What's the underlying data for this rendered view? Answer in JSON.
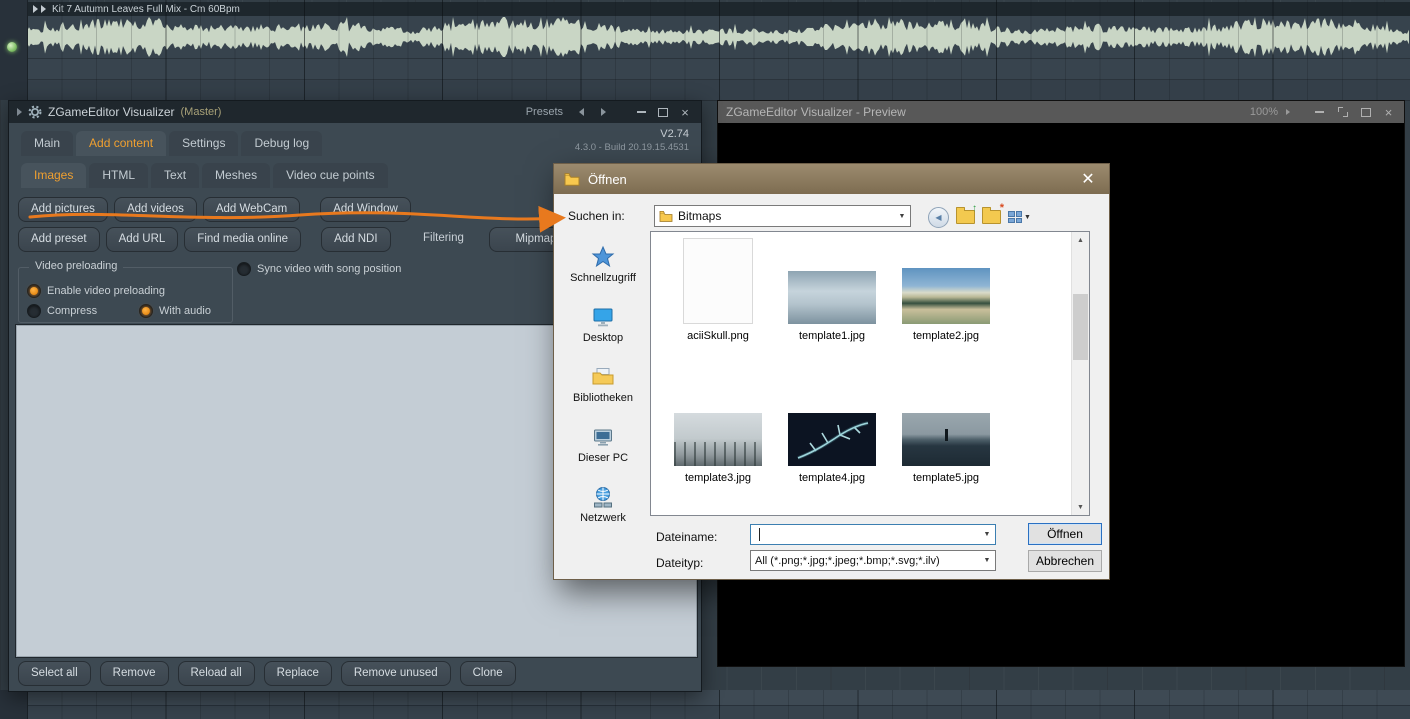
{
  "colors": {
    "accent_orange": "#f08a1d",
    "arrow_orange": "#e8791e",
    "dialog_titlebar": "#8a795f",
    "focus_blue": "#2a70c2"
  },
  "playlist": {
    "track_title": "Kit 7 Autumn Leaves Full Mix - Cm 60Bpm"
  },
  "plugin": {
    "title": "ZGameEditor Visualizer",
    "master": "(Master)",
    "presets_label": "Presets",
    "version": "V2.74",
    "build": "4.3.0 - Build 20.19.15.4531",
    "tabs": [
      {
        "label": "Main"
      },
      {
        "label": "Add content"
      },
      {
        "label": "Settings"
      },
      {
        "label": "Debug log"
      }
    ],
    "subtabs": [
      {
        "label": "Images"
      },
      {
        "label": "HTML"
      },
      {
        "label": "Text"
      },
      {
        "label": "Meshes"
      },
      {
        "label": "Video cue points"
      }
    ],
    "buttons_row1": [
      {
        "label": "Add pictures"
      },
      {
        "label": "Add videos"
      },
      {
        "label": "Add WebCam"
      },
      {
        "label": "Add Window"
      }
    ],
    "buttons_row2": [
      {
        "label": "Add preset"
      },
      {
        "label": "Add URL"
      },
      {
        "label": "Find media online"
      },
      {
        "label": "Add NDI"
      }
    ],
    "filtering_label": "Filtering",
    "mipmap_label": "Mipmap",
    "video_preloading": {
      "group_label": "Video preloading",
      "enable_label": "Enable video preloading",
      "compress_label": "Compress",
      "with_audio_label": "With audio",
      "sync_label": "Sync video with song position"
    },
    "bottom_buttons": [
      {
        "label": "Select all"
      },
      {
        "label": "Remove"
      },
      {
        "label": "Reload all"
      },
      {
        "label": "Replace"
      },
      {
        "label": "Remove unused"
      },
      {
        "label": "Clone"
      }
    ]
  },
  "preview": {
    "title": "ZGameEditor Visualizer - Preview",
    "zoom": "100%"
  },
  "dialog": {
    "title": "Öffnen",
    "look_in_label": "Suchen in:",
    "look_in_value": "Bitmaps",
    "places": [
      {
        "label": "Schnellzugriff"
      },
      {
        "label": "Desktop"
      },
      {
        "label": "Bibliotheken"
      },
      {
        "label": "Dieser PC"
      },
      {
        "label": "Netzwerk"
      }
    ],
    "files": [
      {
        "name": "aciiSkull.png"
      },
      {
        "name": "template1.jpg"
      },
      {
        "name": "template2.jpg"
      },
      {
        "name": "template3.jpg"
      },
      {
        "name": "template4.jpg"
      },
      {
        "name": "template5.jpg"
      }
    ],
    "filename_label": "Dateiname:",
    "filename_value": "",
    "filetype_label": "Dateityp:",
    "filetype_value": "All (*.png;*.jpg;*.jpeg;*.bmp;*.svg;*.ilv)",
    "open_label": "Öffnen",
    "cancel_label": "Abbrechen"
  }
}
